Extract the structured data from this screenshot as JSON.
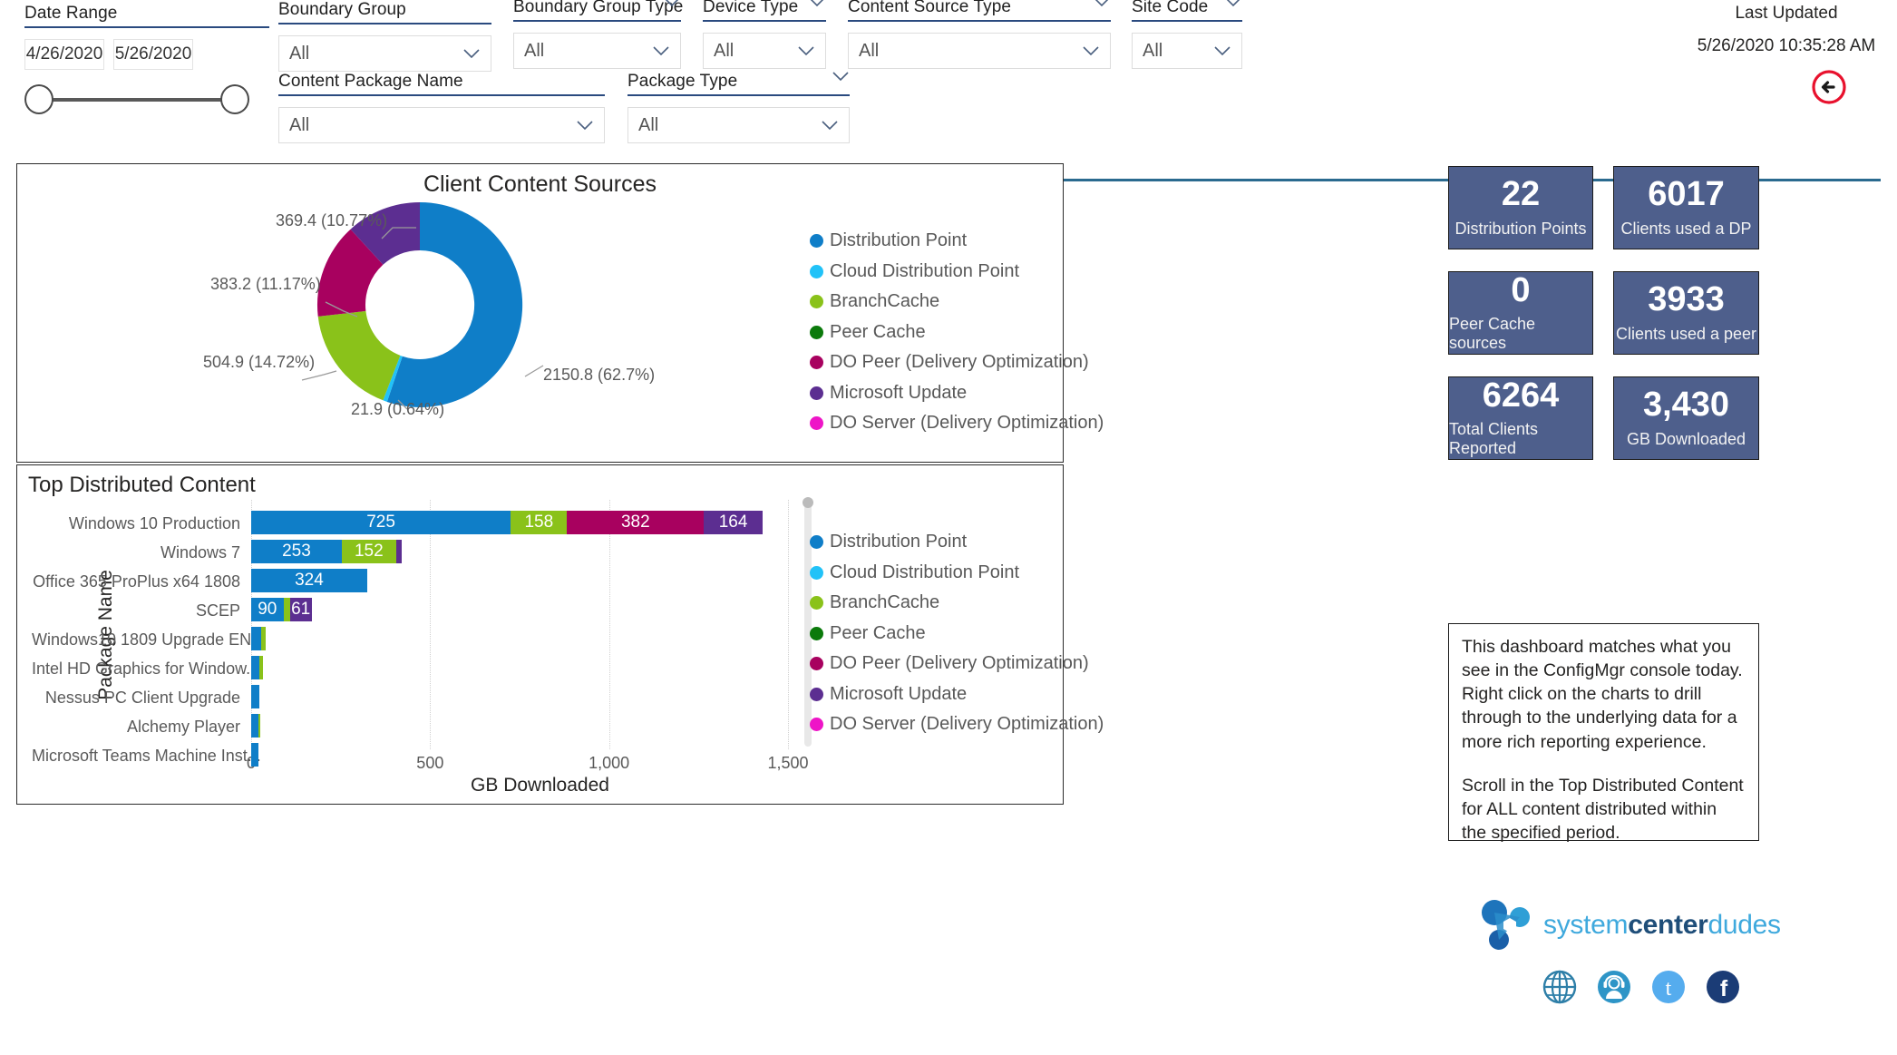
{
  "filters": {
    "date_range": {
      "label": "Date Range",
      "start": "4/26/2020",
      "end": "5/26/2020"
    },
    "slicers": [
      {
        "label": "Boundary Group",
        "value": "All"
      },
      {
        "label": "Boundary Group Type",
        "value": "All"
      },
      {
        "label": "Device Type",
        "value": "All"
      },
      {
        "label": "Content Source Type",
        "value": "All"
      },
      {
        "label": "Site Code",
        "value": "All"
      },
      {
        "label": "Content Package Name",
        "value": "All"
      },
      {
        "label": "Package Type",
        "value": "All"
      }
    ]
  },
  "last_updated": {
    "title": "Last Updated",
    "timestamp": "5/26/2020 10:35:28 AM"
  },
  "back_button": {
    "icon": "back-arrow-icon",
    "color": "#e8112d"
  },
  "kpis": [
    {
      "value": "22",
      "label": "Distribution Points"
    },
    {
      "value": "6017",
      "label": "Clients used a DP"
    },
    {
      "value": "0",
      "label": "Peer Cache sources"
    },
    {
      "value": "3933",
      "label": "Clients used a peer"
    },
    {
      "value": "6264",
      "label": "Total Clients Reported"
    },
    {
      "value": "3,430",
      "label": "GB Downloaded"
    }
  ],
  "info_box": {
    "paragraph1": "This dashboard matches what you see in the ConfigMgr console today. Right click on the charts to drill through to the underlying data for a more rich reporting experience.",
    "paragraph2": "Scroll in the Top Distributed Content for ALL content distributed within the specified period."
  },
  "branding": {
    "logo_prefix": "system",
    "logo_bold": "center",
    "logo_suffix": "dudes",
    "socials": [
      {
        "name": "website-icon",
        "glyph": "⊕",
        "color": "#2e7fa8",
        "style": "outline"
      },
      {
        "name": "support-icon",
        "glyph": "●",
        "color": "#2e95c7",
        "style": "solid"
      },
      {
        "name": "twitter-icon",
        "glyph": "t",
        "color": "#55acee",
        "style": "solid"
      },
      {
        "name": "facebook-icon",
        "glyph": "f",
        "color": "#1b3c76",
        "style": "solid"
      }
    ]
  },
  "chart_data": [
    {
      "type": "pie",
      "title": "Client Content Sources",
      "variant": "donut",
      "unit": "GB",
      "labels": [
        "Distribution Point",
        "Cloud Distribution Point",
        "BranchCache",
        "DO Peer (Delivery Optimization)",
        "Microsoft Update"
      ],
      "values": [
        2150.8,
        21.9,
        504.9,
        383.2,
        369.4
      ],
      "percents": [
        62.7,
        0.64,
        14.72,
        11.17,
        10.77
      ],
      "data_labels": [
        "2150.8 (62.7%)",
        "21.9 (0.64%)",
        "504.9 (14.72%)",
        "383.2 (11.17%)",
        "369.4 (10.77%)"
      ],
      "legend_position": "right",
      "legend": [
        {
          "label": "Distribution Point",
          "color": "#0f7ec8"
        },
        {
          "label": "Cloud Distribution Point",
          "color": "#21c2f8"
        },
        {
          "label": "BranchCache",
          "color": "#8ac21a"
        },
        {
          "label": "Peer Cache",
          "color": "#0b7a0b"
        },
        {
          "label": "DO Peer (Delivery Optimization)",
          "color": "#a8015f"
        },
        {
          "label": "Microsoft Update",
          "color": "#5c2e91"
        },
        {
          "label": "DO Server (Delivery Optimization)",
          "color": "#ee15c7"
        }
      ]
    },
    {
      "type": "bar",
      "variant": "stacked-horizontal",
      "title": "Top Distributed Content",
      "xlabel": "GB Downloaded",
      "ylabel": "Package Name",
      "xlim": [
        0,
        1500
      ],
      "xticks": [
        "0",
        "500",
        "1,000",
        "1,500"
      ],
      "grid": true,
      "legend_position": "right",
      "legend": [
        {
          "label": "Distribution Point",
          "color": "#0f7ec8"
        },
        {
          "label": "Cloud Distribution Point",
          "color": "#21c2f8"
        },
        {
          "label": "BranchCache",
          "color": "#8ac21a"
        },
        {
          "label": "Peer Cache",
          "color": "#0b7a0b"
        },
        {
          "label": "DO Peer (Delivery Optimization)",
          "color": "#a8015f"
        },
        {
          "label": "Microsoft Update",
          "color": "#5c2e91"
        },
        {
          "label": "DO Server (Delivery Optimization)",
          "color": "#ee15c7"
        }
      ],
      "categories": [
        "Windows 10 Production",
        "Windows 7",
        "Office 365 ProPlus x64 1808",
        "SCEP",
        "Windows10 1809 Upgrade EN",
        "Intel HD Graphics for Window...",
        "Nessus PC Client Upgrade",
        "Alchemy Player",
        "Microsoft Teams Machine Inst..."
      ],
      "rows": [
        {
          "category": "Windows 10 Production",
          "segments": [
            {
              "series": "Distribution Point",
              "value": 725,
              "label": "725"
            },
            {
              "series": "BranchCache",
              "value": 158,
              "label": "158"
            },
            {
              "series": "DO Peer (Delivery Optimization)",
              "value": 382,
              "label": "382"
            },
            {
              "series": "Microsoft Update",
              "value": 164,
              "label": "164"
            }
          ]
        },
        {
          "category": "Windows 7",
          "segments": [
            {
              "series": "Distribution Point",
              "value": 253,
              "label": "253"
            },
            {
              "series": "BranchCache",
              "value": 152,
              "label": "152"
            },
            {
              "series": "Microsoft Update",
              "value": 16,
              "label": ""
            }
          ]
        },
        {
          "category": "Office 365 ProPlus x64 1808",
          "segments": [
            {
              "series": "Distribution Point",
              "value": 324,
              "label": "324"
            }
          ]
        },
        {
          "category": "SCEP",
          "segments": [
            {
              "series": "Distribution Point",
              "value": 90,
              "label": "90"
            },
            {
              "series": "BranchCache",
              "value": 18,
              "label": ""
            },
            {
              "series": "Microsoft Update",
              "value": 61,
              "label": "61"
            }
          ]
        },
        {
          "category": "Windows10 1809 Upgrade EN",
          "segments": [
            {
              "series": "Distribution Point",
              "value": 28,
              "label": ""
            },
            {
              "series": "BranchCache",
              "value": 12,
              "label": ""
            }
          ]
        },
        {
          "category": "Intel HD Graphics for Window...",
          "segments": [
            {
              "series": "Distribution Point",
              "value": 22,
              "label": ""
            },
            {
              "series": "BranchCache",
              "value": 11,
              "label": ""
            }
          ]
        },
        {
          "category": "Nessus PC Client Upgrade",
          "segments": [
            {
              "series": "Distribution Point",
              "value": 22,
              "label": ""
            }
          ]
        },
        {
          "category": "Alchemy Player",
          "segments": [
            {
              "series": "Distribution Point",
              "value": 20,
              "label": ""
            },
            {
              "series": "BranchCache",
              "value": 6,
              "label": ""
            }
          ]
        },
        {
          "category": "Microsoft Teams Machine Inst...",
          "segments": [
            {
              "series": "Distribution Point",
              "value": 20,
              "label": ""
            }
          ]
        }
      ]
    }
  ]
}
